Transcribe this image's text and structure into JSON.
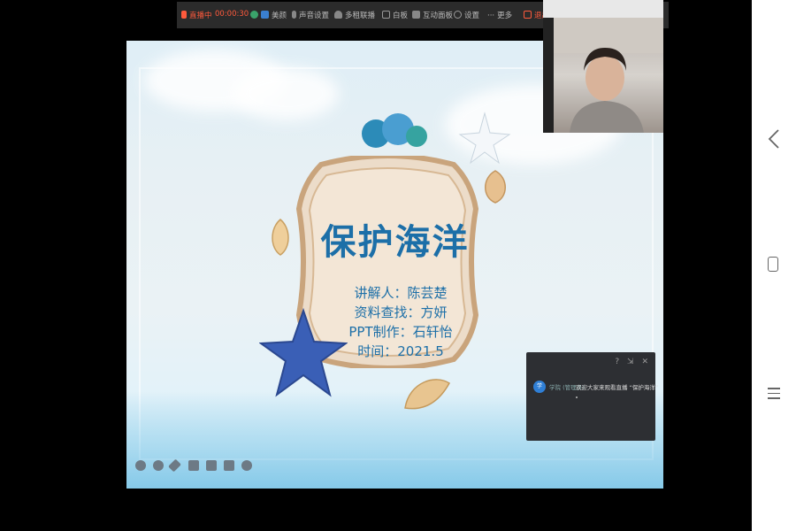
{
  "toolbar": {
    "status": "直播中",
    "timer": "00:00:30",
    "items": [
      {
        "label": "美颜",
        "icon": "camera-icon"
      },
      {
        "label": "声音设置",
        "icon": "microphone-icon"
      },
      {
        "label": "多租联播",
        "icon": "user-icon"
      },
      {
        "label": "白板",
        "icon": "whiteboard-icon"
      },
      {
        "label": "互动面板",
        "icon": "chat-bubble-icon"
      },
      {
        "label": "设置",
        "icon": "gear-icon"
      },
      {
        "label": "更多",
        "icon": "more-dots-icon"
      },
      {
        "label": "退出",
        "icon": "exit-icon"
      }
    ]
  },
  "slide": {
    "title": "保护海洋",
    "credits": [
      "讲解人：陈芸楚",
      "资料查找：方妍",
      "PPT制作：石轩怡",
      "时间：2021.5"
    ]
  },
  "chat": {
    "avatar_text": "学",
    "user": "学院 (管理员):",
    "message": "欢迎大家来观看直播 “保护海洋”"
  },
  "colors": {
    "accent": "#1c6fa8",
    "live": "#ff5a3c",
    "toolbar_bg": "#2b2b2b"
  }
}
